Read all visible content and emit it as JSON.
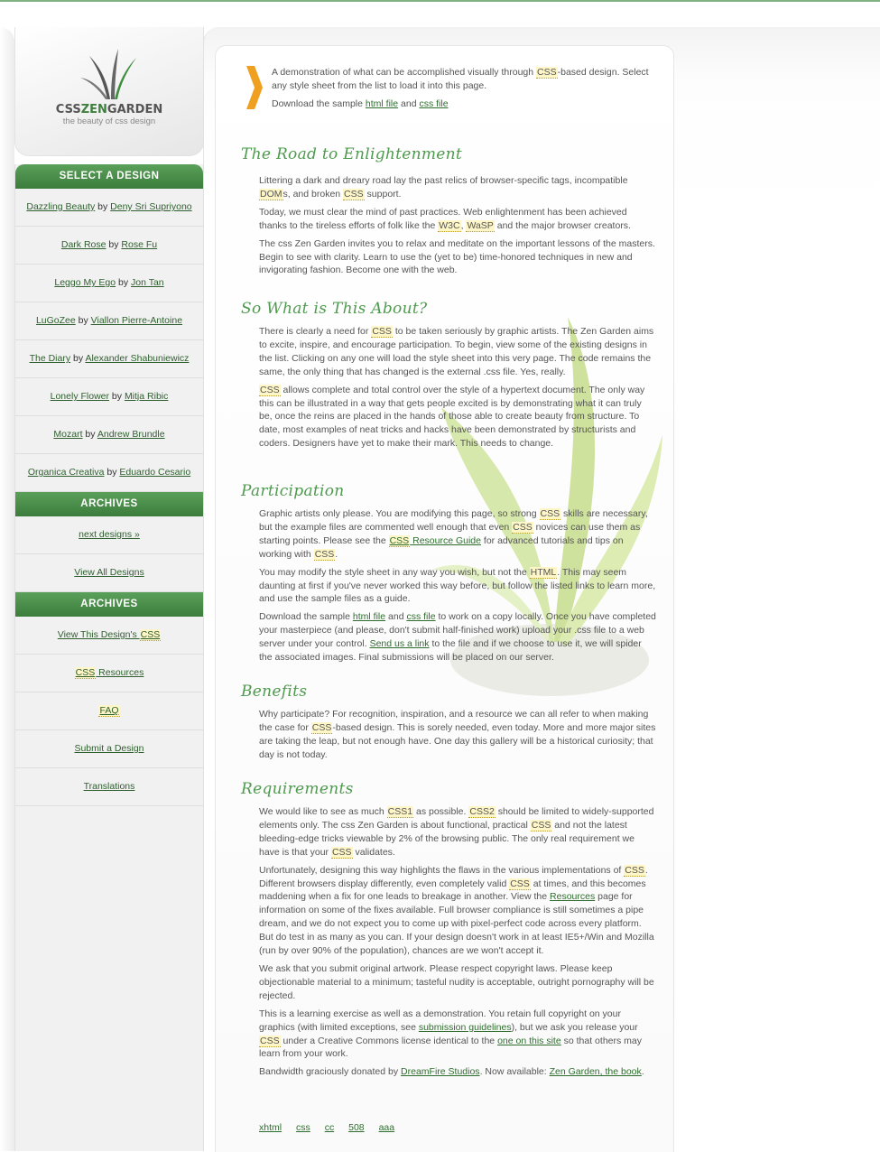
{
  "logo": {
    "title_a": "CSS",
    "title_b": "ZEN",
    "title_c": "GARDEN",
    "subtitle": "the beauty of css design"
  },
  "colors": {
    "green_header": "#4a8c4a",
    "link": "#2f6d2f",
    "title": "#4e9a4e",
    "abbr_bg": "#fff6c8"
  },
  "sidebar": {
    "select_title": "SELECT A DESIGN",
    "designs": [
      {
        "name": "Dazzling Beauty",
        "by": "by",
        "author": "Deny Sri Supriyono"
      },
      {
        "name": "Dark Rose",
        "by": "by",
        "author": "Rose Fu"
      },
      {
        "name": "Leggo My Ego",
        "by": "by",
        "author": "Jon Tan"
      },
      {
        "name": "LuGoZee",
        "by": "by",
        "author": "Viallon Pierre-Antoine"
      },
      {
        "name": "The Diary",
        "by": "by",
        "author": "Alexander Shabuniewicz"
      },
      {
        "name": "Lonely Flower",
        "by": "by",
        "author": "Mitja Ribic"
      },
      {
        "name": "Mozart",
        "by": "by",
        "author": "Andrew Brundle"
      },
      {
        "name": "Organica Creativa",
        "by": "by",
        "author": "Eduardo Cesario"
      }
    ],
    "archives_title": "ARCHIVES",
    "archives": [
      "next designs »",
      "View All Designs"
    ],
    "resources_title": "ARCHIVES",
    "resources": {
      "view_a": "View This Design's ",
      "view_b": "CSS",
      "res_a": "CSS",
      "res_b": " Resources",
      "faq": "FAQ",
      "submit": "Submit a Design",
      "translations": "Translations"
    }
  },
  "intro": {
    "p1_a": "A demonstration of what can be accomplished visually through ",
    "p1_abbr": "CSS",
    "p1_b": "-based design. Select any style sheet from the list to load it into this page.",
    "p2_a": "Download the sample ",
    "p2_link1": "html file",
    "p2_b": " and ",
    "p2_link2": "css file"
  },
  "sections": {
    "road": {
      "title": "The Road to Enlightenment",
      "p1_a": "Littering a dark and dreary road lay the past relics of browser-specific tags, incompatible ",
      "p1_abbr1": "DOM",
      "p1_b": "s, and broken ",
      "p1_abbr2": "CSS",
      "p1_c": " support.",
      "p2_a": "Today, we must clear the mind of past practices. Web enlightenment has been achieved thanks to the tireless efforts of folk like the ",
      "p2_abbr1": "W3C",
      "p2_b": ", ",
      "p2_abbr2": "WaSP",
      "p2_c": " and the major browser creators.",
      "p3": "The css Zen Garden invites you to relax and meditate on the important lessons of the masters. Begin to see with clarity. Learn to use the (yet to be) time-honored techniques in new and invigorating fashion. Become one with the web."
    },
    "about": {
      "title": "So What is This About?",
      "p1_a": "There is clearly a need for ",
      "p1_abbr": "CSS",
      "p1_b": " to be taken seriously by graphic artists. The Zen Garden aims to excite, inspire, and encourage participation. To begin, view some of the existing designs in the list. Clicking on any one will load the style sheet into this very page. The code remains the same, the only thing that has changed is the external .css file. Yes, really.",
      "p2_abbr": "CSS",
      "p2_b": " allows complete and total control over the style of a hypertext document. The only way this can be illustrated in a way that gets people excited is by demonstrating what it can truly be, once the reins are placed in the hands of those able to create beauty from structure. To date, most examples of neat tricks and hacks have been demonstrated by structurists and coders. Designers have yet to make their mark. This needs to change."
    },
    "participation": {
      "title": "Participation",
      "p1_a": "Graphic artists only please. You are modifying this page, so strong ",
      "p1_abbr1": "CSS",
      "p1_b": " skills are necessary, but the example files are commented well enough that even ",
      "p1_abbr2": "CSS",
      "p1_c": " novices can use them as starting points. Please see the ",
      "p1_link_abbr": "CSS",
      "p1_link": " Resource Guide",
      "p1_d": " for advanced tutorials and tips on working with ",
      "p1_abbr3": "CSS",
      "p1_e": ".",
      "p2_a": "You may modify the style sheet in any way you wish, but not the ",
      "p2_abbr": "HTML",
      "p2_b": ". This may seem daunting at first if you've never worked this way before, but follow the listed links to learn more, and use the sample files as a guide.",
      "p3_a": "Download the sample ",
      "p3_link1": "html file",
      "p3_b": " and ",
      "p3_link2": "css file",
      "p3_c": " to work on a copy locally. Once you have completed your masterpiece (and please, don't submit half-finished work) upload your .css file to a web server under your control. ",
      "p3_link3": "Send us a link",
      "p3_d": " to the file and if we choose to use it, we will spider the associated images. Final submissions will be placed on our server."
    },
    "benefits": {
      "title": "Benefits",
      "p1_a": "Why participate? For recognition, inspiration, and a resource we can all refer to when making the case for ",
      "p1_abbr": "CSS",
      "p1_b": "-based design. This is sorely needed, even today. More and more major sites are taking the leap, but not enough have. One day this gallery will be a historical curiosity; that day is not today."
    },
    "requirements": {
      "title": "Requirements",
      "p1_a": "We would like to see as much ",
      "p1_abbr1": "CSS1",
      "p1_b": " as possible. ",
      "p1_abbr2": "CSS2",
      "p1_c": " should be limited to widely-supported elements only. The css Zen Garden is about functional, practical ",
      "p1_abbr3": "CSS",
      "p1_d": " and not the latest bleeding-edge tricks viewable by 2% of the browsing public. The only real requirement we have is that your ",
      "p1_abbr4": "CSS",
      "p1_e": " validates.",
      "p2_a": "Unfortunately, designing this way highlights the flaws in the various implementations of ",
      "p2_abbr1": "CSS",
      "p2_b": ". Different browsers display differently, even completely valid ",
      "p2_abbr2": "CSS",
      "p2_c": " at times, and this becomes maddening when a fix for one leads to breakage in another. View the ",
      "p2_link": "Resources",
      "p2_d": " page for information on some of the fixes available. Full browser compliance is still sometimes a pipe dream, and we do not expect you to come up with pixel-perfect code across every platform. But do test in as many as you can. If your design doesn't work in at least IE5+/Win and Mozilla (run by over 90% of the population), chances are we won't accept it.",
      "p3": "We ask that you submit original artwork. Please respect copyright laws. Please keep objectionable material to a minimum; tasteful nudity is acceptable, outright pornography will be rejected.",
      "p4_a": "This is a learning exercise as well as a demonstration. You retain full copyright on your graphics (with limited exceptions, see ",
      "p4_link1": "submission guidelines",
      "p4_b": "), but we ask you release your ",
      "p4_abbr": "CSS",
      "p4_c": " under a Creative Commons license identical to the ",
      "p4_link2": "one on this site",
      "p4_d": " so that others may learn from your work.",
      "p5_a": "Bandwidth graciously donated by ",
      "p5_link1": "DreamFire Studios",
      "p5_b": ". Now available: ",
      "p5_link2": "Zen Garden, the book",
      "p5_c": "."
    }
  },
  "footer": [
    "xhtml",
    "css",
    "cc",
    "508",
    "aaa"
  ]
}
